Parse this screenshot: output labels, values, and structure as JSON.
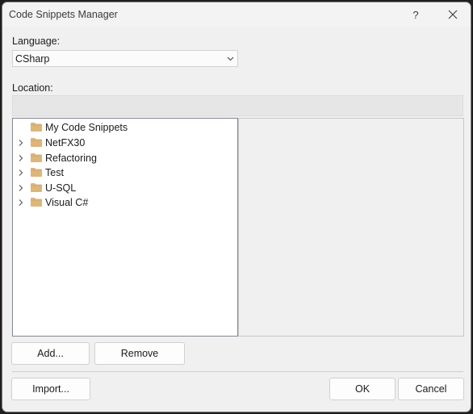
{
  "window": {
    "title": "Code Snippets Manager",
    "help_label": "?",
    "close_label": "✕"
  },
  "language": {
    "label": "Language:",
    "selected": "CSharp"
  },
  "location": {
    "label": "Location:",
    "value": ""
  },
  "tree": {
    "items": [
      {
        "label": "My Code Snippets",
        "expandable": false
      },
      {
        "label": "NetFX30",
        "expandable": true
      },
      {
        "label": "Refactoring",
        "expandable": true
      },
      {
        "label": "Test",
        "expandable": true
      },
      {
        "label": "U-SQL",
        "expandable": true
      },
      {
        "label": "Visual C#",
        "expandable": true
      }
    ]
  },
  "buttons": {
    "add": "Add...",
    "remove": "Remove",
    "import": "Import...",
    "ok": "OK",
    "cancel": "Cancel"
  },
  "colors": {
    "folder": "#dcb67a",
    "background": "#f0f0f0"
  }
}
